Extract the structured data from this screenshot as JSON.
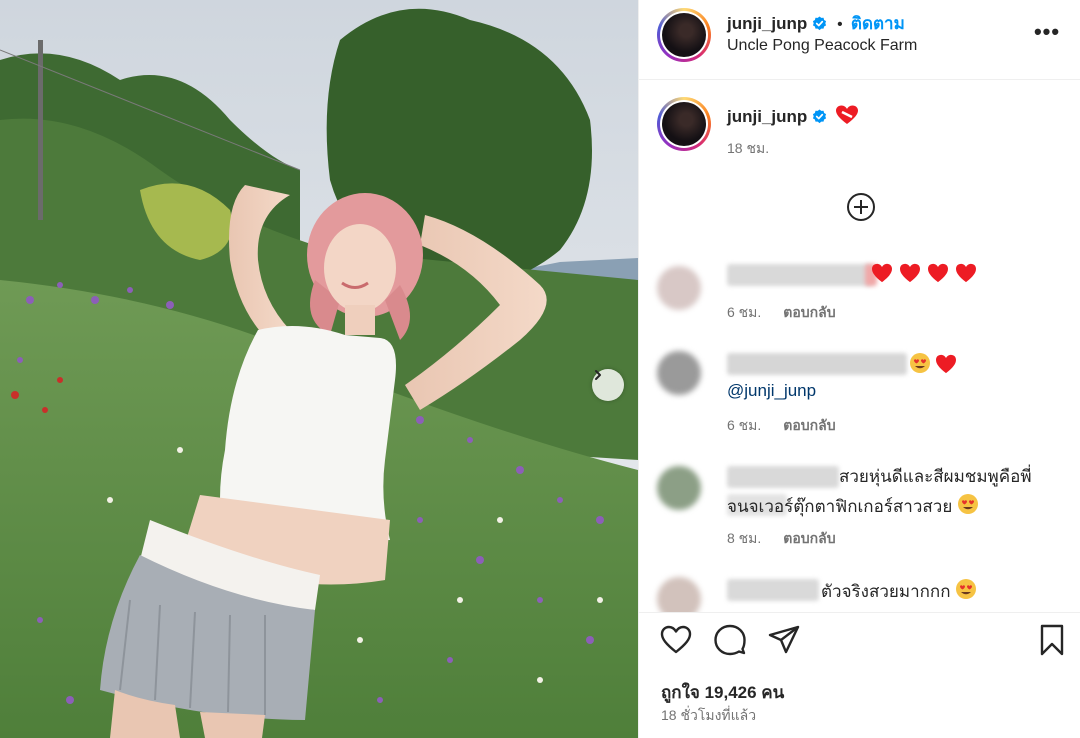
{
  "post": {
    "username": "junji_junp",
    "follow_separator": "•",
    "follow_label": "ติดตาม",
    "location": "Uncle Pong Peacock Farm",
    "more_label": "•••"
  },
  "caption": {
    "username": "junji_junp",
    "time": "18 ชม."
  },
  "comments": [
    {
      "text": "",
      "time": "6 ชม.",
      "reply_label": "ตอบกลับ"
    },
    {
      "text": "",
      "mention": "@junji_junp",
      "time": "6 ชม.",
      "reply_label": "ตอบกลับ"
    },
    {
      "line1": "สวยหุ่นดีและสีผมชมพูคือพี่",
      "line2": "จนจเวอร์ตุ๊กตาฟิกเกอร์สาวสวย",
      "time": "8 ชม.",
      "reply_label": "ตอบกลับ"
    },
    {
      "text": "ตัวจริงสวยมากกก"
    }
  ],
  "footer": {
    "likes": "ถูกใจ 19,426 คน",
    "posted": "18 ชั่วโมงที่แล้ว"
  },
  "colors": {
    "accent": "#0095f6",
    "verified": "#0095f6",
    "heart": "#ed1c24",
    "text": "#262626",
    "muted": "#737373"
  }
}
